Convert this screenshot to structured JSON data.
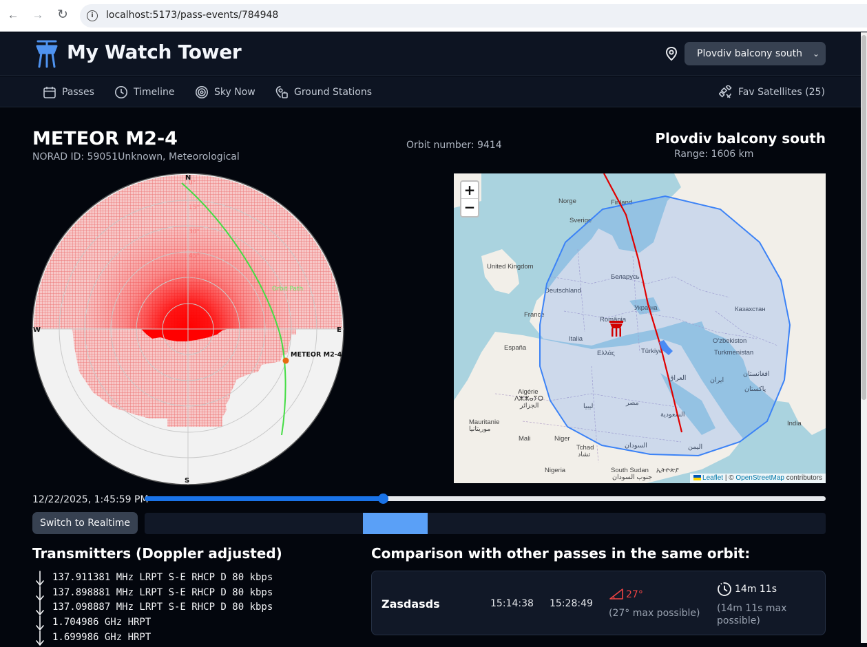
{
  "browser": {
    "url": "localhost:5173/pass-events/784948",
    "back_glyph": "←",
    "forward_glyph": "→",
    "reload_glyph": "↻",
    "info_glyph": "i"
  },
  "header": {
    "app_title": "My Watch Tower",
    "location_selected": "Plovdiv balcony south",
    "chevron_glyph": "⌄"
  },
  "nav": {
    "items": [
      {
        "label": "Passes",
        "icon": "calendar-icon"
      },
      {
        "label": "Timeline",
        "icon": "clock-icon"
      },
      {
        "label": "Sky Now",
        "icon": "radar-icon"
      },
      {
        "label": "Ground Stations",
        "icon": "ground-station-icon"
      }
    ],
    "fav_label": "Fav Satellites (25)"
  },
  "pass": {
    "satellite_name": "METEOR M2-4",
    "norad_line": "NORAD ID: 59051Unknown, Meteorological",
    "orbit_line": "Orbit number: 9414",
    "station_name": "Plovdiv balcony south",
    "range_line": "Range: 1606 km"
  },
  "polar": {
    "north": "N",
    "south": "S",
    "east": "E",
    "west": "W",
    "ring_labels": [
      "0°",
      "15°",
      "30°",
      "45°",
      "60°"
    ],
    "orbit_label": "Orbit Path",
    "satellite_label": "METEOR M2-4",
    "colors": {
      "horizon_mask": "#ff0000",
      "orbit": "#44dd44",
      "satellite": "#e86a10"
    }
  },
  "map": {
    "zoom_in": "+",
    "zoom_out": "−",
    "attribution_leaflet": "Leaflet",
    "attribution_sep": " | © ",
    "attribution_osm": "OpenStreetMap",
    "attribution_tail": " contributors",
    "place_labels": [
      "Norge",
      "Sverige",
      "Finland",
      "United Kingdom",
      "Deutschland",
      "Беларусь",
      "Україна",
      "Казахстан",
      "France",
      "România",
      "Italia",
      "España",
      "Ελλάς",
      "Türkiye",
      "O'zbekiston",
      "Turkmenistan",
      "العراق",
      "ایران",
      "افغانستان",
      "پاکستان",
      "Algérie",
      "ⴷⵣⵣⴰⵢⵔ",
      "الجزائر",
      "ليبيا",
      "مصر",
      "السعودية",
      "Mauritanie",
      "موريتانيا",
      "Mali",
      "Niger",
      "Tchad",
      "تشاد",
      "السودان",
      "اليمن",
      "India",
      "Nigeria",
      "South Sudan",
      "جنوب السودان",
      "ኢትዮጵያ"
    ],
    "colors": {
      "footprint": "#3b82f6",
      "ground_track": "#e00000",
      "station": "#d00000"
    }
  },
  "timeline": {
    "timestamp": "12/22/2025, 1:45:59 PM",
    "slider_progress": 0.35,
    "realtime_button": "Switch to Realtime",
    "segment_start": 0.321,
    "segment_end": 0.416
  },
  "transmitters": {
    "title": "Transmitters (Doppler adjusted)",
    "items": [
      "137.911381 MHz LRPT S-E RHCP D 80 kbps",
      "137.898881 MHz LRPT S-E RHCP D 80 kbps",
      "137.098887 MHz LRPT S-E RHCP D 80 kbps",
      "1.704986 GHz HRPT",
      "1.699986 GHz HRPT"
    ]
  },
  "comparison": {
    "title": "Comparison with other passes in the same orbit:",
    "rows": [
      {
        "station": "Zasdasds",
        "start": "15:14:38",
        "end": "15:28:49",
        "max_elevation": "27°",
        "max_possible_elevation": "(27° max possible)",
        "duration": "14m 11s",
        "max_possible_duration": "(14m 11s max possible)"
      }
    ]
  }
}
